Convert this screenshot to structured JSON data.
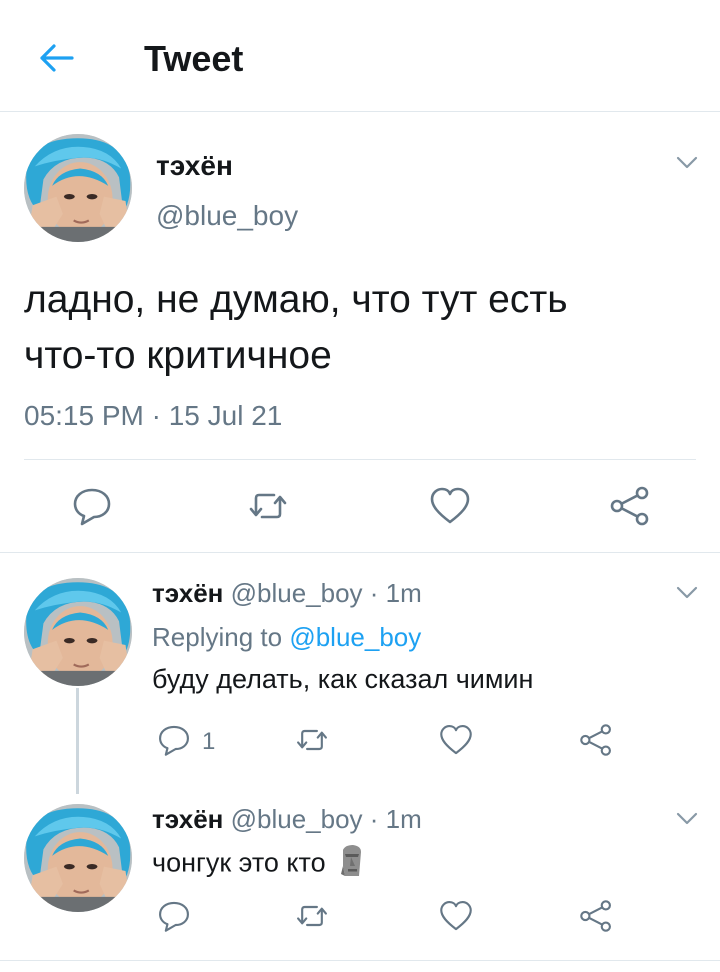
{
  "header": {
    "title": "Tweet",
    "back_icon": "arrow-left-icon"
  },
  "colors": {
    "accent": "#1da1f2",
    "text": "#14171a",
    "muted": "#657786",
    "divider": "#e1e8ed",
    "thread": "#ccd6dd"
  },
  "main_tweet": {
    "name": "тэхён",
    "handle": "@blue_boy",
    "text_line1": "ладно, не думаю, что тут есть",
    "text_line2": "что-то критичное",
    "timestamp": "05:15 PM · 15 Jul 21",
    "actions": [
      "reply-icon",
      "retweet-icon",
      "like-icon",
      "share-icon"
    ]
  },
  "replies": [
    {
      "name": "тэхён",
      "meta": "@blue_boy · 1m",
      "replying_prefix": "Replying to",
      "replying_handle": "@blue_boy",
      "text": "буду делать, как сказал чимин",
      "reply_count": "1"
    },
    {
      "name": "тэхён",
      "meta": "@blue_boy · 1m",
      "text": "чонгук это кто",
      "emoji": "moai-emoji"
    }
  ]
}
